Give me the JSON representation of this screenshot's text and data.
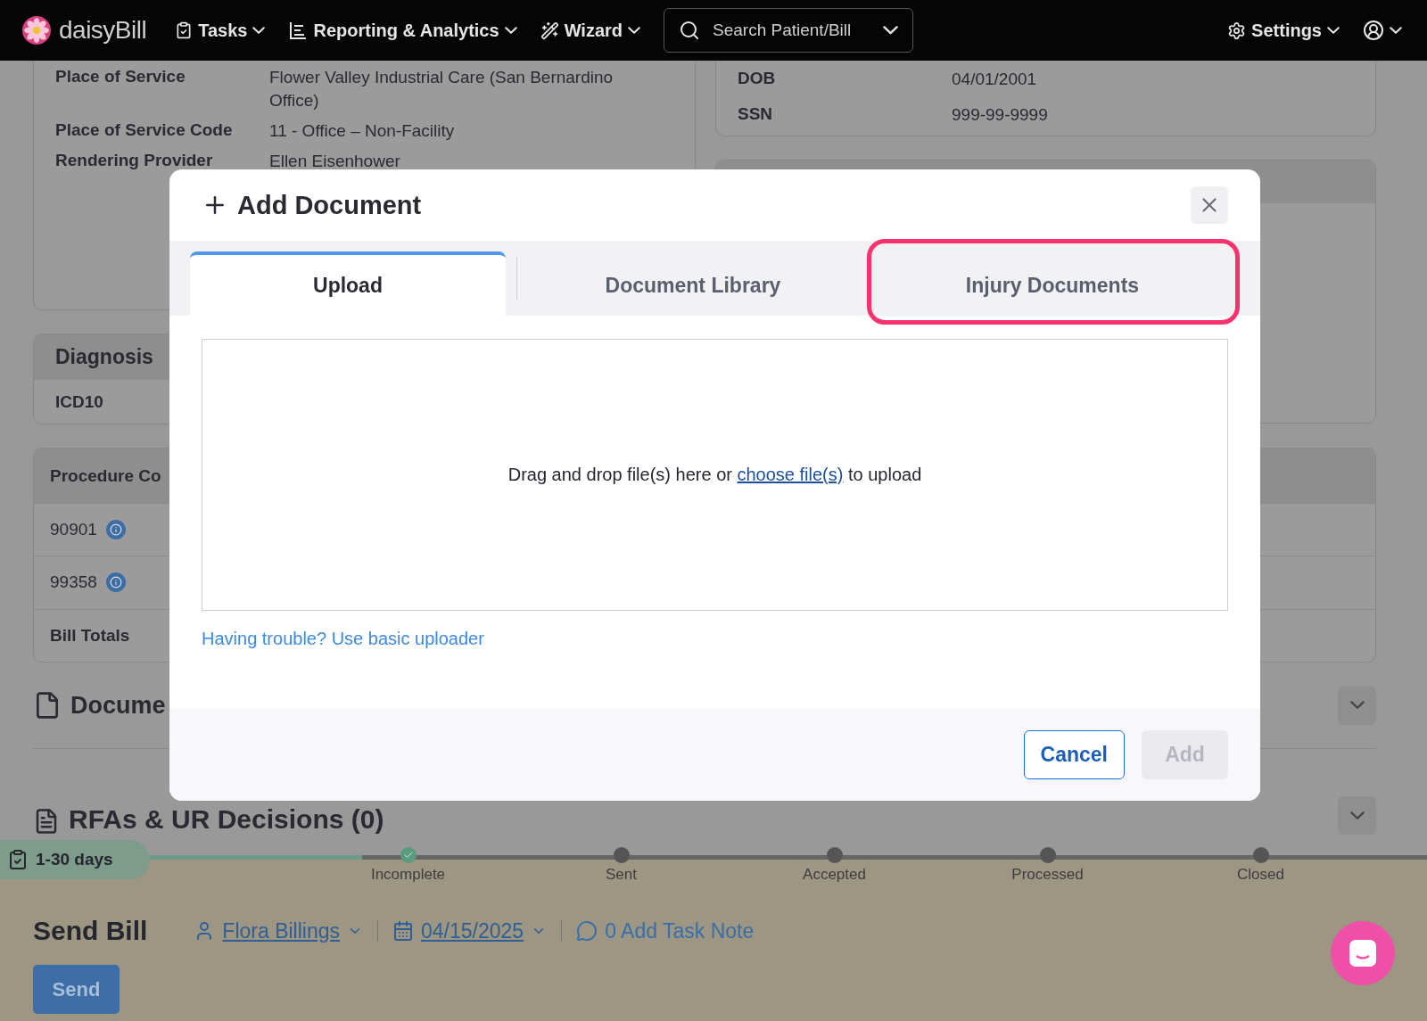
{
  "topbar": {
    "brand": "daisyBill",
    "nav": [
      {
        "label": "Tasks"
      },
      {
        "label": "Reporting & Analytics"
      },
      {
        "label": "Wizard"
      }
    ],
    "search": {
      "placeholder": "Search Patient/Bill"
    },
    "settings": "Settings"
  },
  "service": [
    {
      "label": "Place of Service",
      "value": "Flower Valley Industrial Care (San Bernardino Office)"
    },
    {
      "label": "Place of Service Code",
      "value": "11 - Office – Non-Facility"
    },
    {
      "label": "Rendering Provider",
      "value": "Ellen Eisenhower"
    }
  ],
  "patient": [
    {
      "label": "DOB",
      "value": "04/01/2001"
    },
    {
      "label": "SSN",
      "value": "999-99-9999"
    }
  ],
  "diagnosis": {
    "title": "Diagnosis",
    "row": "ICD10"
  },
  "procedures": {
    "header": "Procedure Co",
    "rows": [
      {
        "code": "90901"
      },
      {
        "code": "99358"
      }
    ],
    "totals": "Bill Totals"
  },
  "sections": [
    {
      "title": "Docume"
    },
    {
      "title": "RFAs & UR Decisions (0)"
    }
  ],
  "timeline": {
    "badge": "1-30 days",
    "steps": [
      {
        "label": "Incomplete",
        "done": true
      },
      {
        "label": "Sent",
        "done": false
      },
      {
        "label": "Accepted",
        "done": false
      },
      {
        "label": "Processed",
        "done": false
      },
      {
        "label": "Closed",
        "done": false
      }
    ]
  },
  "task": {
    "title": "Send Bill",
    "assignee": "Flora Billings",
    "date": "04/15/2025",
    "note": "0 Add Task Note",
    "button": "Send"
  },
  "modal": {
    "title": "Add Document",
    "tabs": [
      {
        "label": "Upload",
        "selected": true,
        "highlighted": false
      },
      {
        "label": "Document Library",
        "selected": false,
        "highlighted": false
      },
      {
        "label": "Injury Documents",
        "selected": false,
        "highlighted": true
      }
    ],
    "drop": {
      "before": "Drag and drop file(s) here or",
      "link": "choose file(s)",
      "after": "to upload"
    },
    "help_link": "Having trouble? Use basic uploader",
    "buttons": [
      {
        "label": "Cancel",
        "disabled": false
      },
      {
        "label": "Add",
        "disabled": true
      }
    ]
  }
}
